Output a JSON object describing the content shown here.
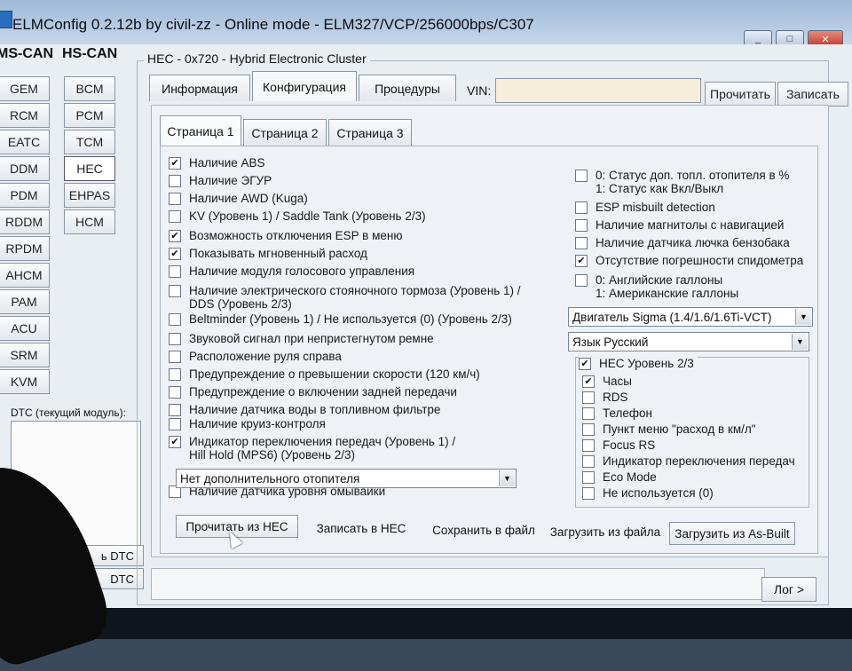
{
  "window": {
    "title": "ELMConfig 0.2.12b by civil-zz - Online mode - ELM327/VCP/256000bps/C307",
    "minimize": "_",
    "maximize": "□",
    "close": "✕"
  },
  "sidebar": {
    "ms_can_label": "MS-CAN",
    "hs_can_label": "HS-CAN",
    "ms_can_modules": [
      "GEM",
      "RCM",
      "EATC",
      "DDM",
      "PDM",
      "RDDM",
      "RPDM",
      "AHCM",
      "PAM",
      "ACU",
      "SRM",
      "KVM"
    ],
    "hs_can_modules": [
      "BCM",
      "PCM",
      "TCM",
      "HEC",
      "EHPAS",
      "HCM"
    ],
    "selected_module": "HEC",
    "dtc_label": "DTC (текущий модуль):",
    "read_dtc": "ь DTC",
    "clear_dtc": "DTC"
  },
  "module": {
    "group_title": "HEC - 0x720 - Hybrid Electronic Cluster",
    "tabs": [
      "Информация",
      "Конфигурация",
      "Процедуры"
    ],
    "active_tab": "Конфигурация",
    "vin_label": "VIN:",
    "vin_value": "",
    "read_button": "Прочитать",
    "write_button": "Записать"
  },
  "pages": {
    "tabs": [
      "Страница 1",
      "Страница 2",
      "Страница 3"
    ],
    "active": "Страница 1"
  },
  "left_options": [
    {
      "label": "Наличие ABS",
      "checked": true
    },
    {
      "label": "Наличие ЭГУР",
      "checked": false
    },
    {
      "label": "Наличие AWD (Kuga)",
      "checked": false
    },
    {
      "label": "KV (Уровень 1) / Saddle Tank (Уровень 2/3)",
      "checked": false
    },
    {
      "label": "Возможность отключения ESP в меню",
      "checked": true
    },
    {
      "label": "Показывать мгновенный расход",
      "checked": true
    },
    {
      "label": "Наличие модуля голосового управления",
      "checked": false
    },
    {
      "label": "Наличие электрического стояночного тормоза (Уровень 1) /",
      "label2": "DDS (Уровень 2/3)",
      "checked": false
    },
    {
      "label": "Beltminder (Уровень 1) / Не используется (0) (Уровень 2/3)",
      "checked": false
    },
    {
      "label": "Звуковой сигнал при непристегнутом ремне",
      "checked": false
    },
    {
      "label": "Расположение руля справа",
      "checked": false
    },
    {
      "label": "Предупреждение о превышении скорости (120 км/ч)",
      "checked": false
    },
    {
      "label": "Предупреждение о включении задней передачи",
      "checked": false
    },
    {
      "label": "Наличие датчика воды в топливном фильтре",
      "checked": false
    },
    {
      "label": "Наличие круиз-контроля",
      "checked": false
    },
    {
      "label": "Индикатор переключения передач (Уровень 1) /",
      "label2": "Hill Hold (MPS6) (Уровень 2/3)",
      "checked": true
    },
    {
      "label": "Наличие датчика уровня омывайки",
      "checked": false
    }
  ],
  "heater_dropdown": "Нет дополнительного отопителя",
  "right_options": [
    {
      "label": "0: Статус доп. топл. отопителя в %",
      "label2": "1: Статус как Вкл/Выкл",
      "checked": false
    },
    {
      "label": "ESP misbuilt detection",
      "checked": false
    },
    {
      "label": "Наличие магнитолы с навигацией",
      "checked": false
    },
    {
      "label": "Наличие датчика лючка бензобака",
      "checked": false
    },
    {
      "label": "Отсутствие погрешности спидометра",
      "checked": true
    },
    {
      "label": "0: Английские галлоны",
      "label2": "1: Американские галлоны",
      "checked": false
    }
  ],
  "engine_dropdown": "Двигатель Sigma (1.4/1.6/1.6Ti-VCT)",
  "language_dropdown": "Язык Русский",
  "hec_level": {
    "label": "HEC Уровень 2/3",
    "checked": true,
    "items": [
      {
        "label": "Часы",
        "checked": true
      },
      {
        "label": "RDS",
        "checked": false
      },
      {
        "label": "Телефон",
        "checked": false
      },
      {
        "label": "Пункт меню \"расход в км/л\"",
        "checked": false
      },
      {
        "label": "Focus RS",
        "checked": false
      },
      {
        "label": "Индикатор переключения передач",
        "checked": false
      },
      {
        "label": "Eco Mode",
        "checked": false
      },
      {
        "label": "Не используется (0)",
        "checked": false
      }
    ]
  },
  "actions": {
    "read_from_hec": "Прочитать из HEC",
    "write_to_hec": "Записать в HEC",
    "save_to_file": "Сохранить в файл",
    "load_from_file": "Загрузить из файла",
    "load_as_built": "Загрузить из As-Built"
  },
  "log_button": "Лог >"
}
